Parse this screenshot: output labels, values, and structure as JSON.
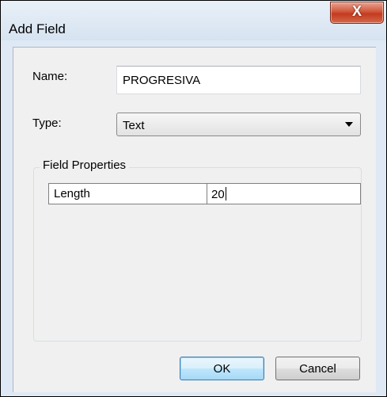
{
  "window": {
    "title": "Add Field",
    "close_glyph": "X"
  },
  "form": {
    "name_label": "Name:",
    "name_value": "PROGRESIVA",
    "type_label": "Type:",
    "type_value": "Text"
  },
  "field_properties": {
    "group_title": "Field Properties",
    "rows": [
      {
        "property": "Length",
        "value": "20"
      }
    ]
  },
  "buttons": {
    "ok_label": "OK",
    "cancel_label": "Cancel"
  },
  "colors": {
    "title_bar": "#dbe6f3",
    "close_button": "#c84a2f",
    "dialog_face": "#f0f0f0",
    "default_button": "#bee6fd"
  }
}
